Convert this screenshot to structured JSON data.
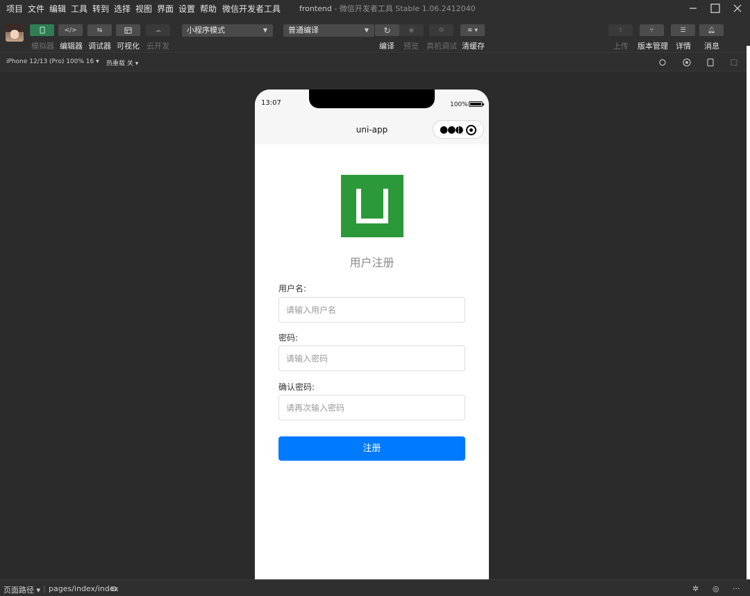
{
  "menubar": {
    "items": [
      "项目",
      "文件",
      "编辑",
      "工具",
      "转到",
      "选择",
      "视图",
      "界面",
      "设置",
      "帮助",
      "微信开发者工具"
    ],
    "project_name": "frontend",
    "app_title": "微信开发者工具 Stable 1.06.2412040"
  },
  "toolbar": {
    "simulator_label": "模拟器",
    "editor_label": "编辑器",
    "debugger_label": "调试器",
    "visual_label": "可视化",
    "cloud_label": "云开发",
    "mode_select": "小程序模式",
    "compile_select": "普通编译",
    "compile_label": "编译",
    "preview_label": "预览",
    "remote_debug_label": "真机调试",
    "clear_cache_label": "清缓存",
    "upload_label": "上传",
    "version_label": "版本管理",
    "details_label": "详情",
    "messages_label": "消息",
    "accent_color": "#2f7d52"
  },
  "subbar": {
    "device": "iPhone 12/13 (Pro) 100% 16",
    "hot_reload": "热重载 关"
  },
  "phone": {
    "time": "13:07",
    "battery": "100%",
    "nav_title": "uni-app",
    "logo_color": "#2b9939",
    "page_title": "用户注册",
    "form": {
      "username_label": "用户名:",
      "username_placeholder": "请输入用户名",
      "password_label": "密码:",
      "password_placeholder": "请输入密码",
      "confirm_label": "确认密码:",
      "confirm_placeholder": "请再次输入密码",
      "submit_label": "注册",
      "submit_color": "#007aff"
    }
  },
  "bottombar": {
    "page_path_label": "页面路径",
    "page_path": "pages/index/index"
  }
}
